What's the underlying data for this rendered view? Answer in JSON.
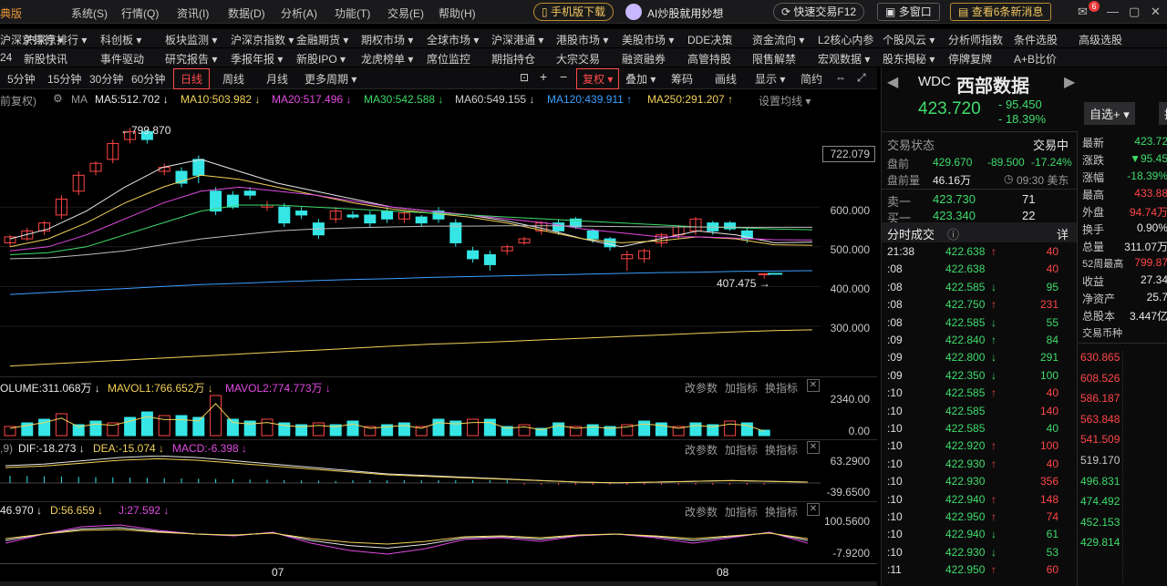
{
  "menubar": {
    "logo": "典版",
    "items": [
      "系统(S)",
      "行情(Q)",
      "资讯(I)",
      "数据(D)",
      "分析(A)",
      "功能(T)",
      "交易(E)",
      "帮助(H)"
    ],
    "mobile_download": "手机版下载",
    "ai_promo": "AI炒股就用妙想",
    "quick_trade": "快速交易F12",
    "multi_window": "多窗口",
    "news": "查看6条新消息",
    "mail_badge": "6"
  },
  "nav1": [
    "沪深京排行 ▾",
    "科创板 ▾",
    "板块监测 ▾",
    "沪深京指数 ▾",
    "金融期货 ▾",
    "期权市场 ▾",
    "全球市场 ▾",
    "沪深港通 ▾",
    "港股市场 ▾",
    "美股市场 ▾",
    "DDE决策",
    "资金流向 ▾",
    "L2核心内参",
    "个股风云 ▾",
    "分析师指数",
    "条件选股",
    "高级选股"
  ],
  "nav2": [
    "新股快讯",
    "事件驱动",
    "研究报告 ▾",
    "季报年报 ▾",
    "新股IPO ▾",
    "龙虎榜单 ▾",
    "席位监控",
    "期指持仓",
    "大宗交易",
    "融资融券",
    "高管持股",
    "限售解禁",
    "宏观数据 ▾",
    "股东揭秘 ▾",
    "停牌复牌",
    "A+B比价"
  ],
  "nav2_lead": "24",
  "toolbar": {
    "periods": [
      "5分钟",
      "15分钟",
      "30分钟",
      "60分钟",
      "日线",
      "周线",
      "月线",
      "更多周期 ▾"
    ],
    "active": "日线",
    "icons_text": [
      "+",
      "−"
    ],
    "fq": "复权 ▾",
    "tools": [
      "叠加 ▾",
      "筹码",
      "画线",
      "显示 ▾",
      "简约"
    ]
  },
  "indicators": {
    "prefix": "前复权)",
    "ma_label": "MA",
    "ma5": "MA5:512.702 ↓",
    "ma10": "MA10:503.982 ↓",
    "ma20": "MA20:517.496 ↓",
    "ma30": "MA30:542.588 ↓",
    "ma60": "MA60:549.155 ↓",
    "ma120": "MA120:439.911 ↑",
    "ma250": "MA250:291.207 ↑",
    "set_ma": "设置均线 ▾",
    "volume": "OLUME:311.068万 ↓",
    "mavol1": "MAVOL1:766.652万 ↓",
    "mavol2": "MAVOL2:774.773万 ↓",
    "macd_prefix": ",9)",
    "dif": "DIF:-18.273 ↓",
    "dea": "DEA:-15.074 ↓",
    "macd": "MACD:-6.398 ↓",
    "kdj_k": "46.970 ↓",
    "kdj_d": "D:56.659 ↓",
    "kdj_j": "J:27.592 ↓",
    "change_param": "改参数",
    "add_ind": "加指标",
    "switch_ind": "换指标"
  },
  "price_axis": [
    "722.079",
    "600.000",
    "500.000",
    "400.000",
    "300.000"
  ],
  "vol_axis": [
    "2340.00",
    "0.00"
  ],
  "macd_axis": [
    "63.2900",
    "-39.6500"
  ],
  "kdj_axis": [
    "100.5600",
    "-7.9200"
  ],
  "annotations": {
    "high": "799.870",
    "low": "407.475"
  },
  "months": [
    "07",
    "08"
  ],
  "colors": {
    "up": "#ff4646",
    "down": "#36e6e6",
    "ma5": "#e8e8e8",
    "ma10": "#f3d25a",
    "ma20": "#e24ae2",
    "ma30": "#3fdc6a",
    "ma60": "#bdbdbd",
    "ma120": "#3aa0ff",
    "ma250": "#f3d25a"
  },
  "quote": {
    "code": "WDC",
    "name": "西部数据",
    "price": "423.720",
    "change": "- 95.450",
    "pct": "- 18.39%",
    "watch": "自选+ ▾",
    "extra_btn": "提",
    "status_label": "交易状态",
    "status_value": "交易中",
    "pre_label": "盘前",
    "pre_price": "429.670",
    "pre_change": "-89.500",
    "pre_pct": "-17.24%",
    "pre_vol_label": "盘前量",
    "pre_vol": "46.16万",
    "time": "09:30 美东",
    "sell_label": "卖一",
    "sell_price": "423.730",
    "sell_vol": "71",
    "buy_label": "买一",
    "buy_price": "423.340",
    "buy_vol": "22",
    "ticks_label": "分时成交",
    "detail": "详"
  },
  "ticks": [
    {
      "t": "21:38",
      "p": "422.638",
      "a": "↑",
      "v": "40",
      "c": "red"
    },
    {
      "t": ":08",
      "p": "422.638",
      "a": "",
      "v": "40",
      "c": "red"
    },
    {
      "t": ":08",
      "p": "422.585",
      "a": "↓",
      "v": "95",
      "c": "grn"
    },
    {
      "t": ":08",
      "p": "422.750",
      "a": "↑",
      "v": "231",
      "c": "red"
    },
    {
      "t": ":08",
      "p": "422.585",
      "a": "↓",
      "v": "55",
      "c": "grn"
    },
    {
      "t": ":09",
      "p": "422.840",
      "a": "↑",
      "v": "84",
      "c": "grn"
    },
    {
      "t": ":09",
      "p": "422.800",
      "a": "↓",
      "v": "291",
      "c": "grn"
    },
    {
      "t": ":09",
      "p": "422.350",
      "a": "↓",
      "v": "100",
      "c": "grn"
    },
    {
      "t": ":10",
      "p": "422.585",
      "a": "↑",
      "v": "40",
      "c": "red"
    },
    {
      "t": ":10",
      "p": "422.585",
      "a": "",
      "v": "140",
      "c": "red"
    },
    {
      "t": ":10",
      "p": "422.585",
      "a": "",
      "v": "40",
      "c": "grn"
    },
    {
      "t": ":10",
      "p": "422.920",
      "a": "↑",
      "v": "100",
      "c": "red"
    },
    {
      "t": ":10",
      "p": "422.930",
      "a": "↑",
      "v": "40",
      "c": "red"
    },
    {
      "t": ":10",
      "p": "422.930",
      "a": "",
      "v": "356",
      "c": "red"
    },
    {
      "t": ":10",
      "p": "422.940",
      "a": "↑",
      "v": "148",
      "c": "red"
    },
    {
      "t": ":10",
      "p": "422.950",
      "a": "↑",
      "v": "74",
      "c": "red"
    },
    {
      "t": ":10",
      "p": "422.940",
      "a": "↓",
      "v": "61",
      "c": "grn"
    },
    {
      "t": ":10",
      "p": "422.930",
      "a": "↓",
      "v": "53",
      "c": "grn"
    },
    {
      "t": ":11",
      "p": "422.950",
      "a": "↑",
      "v": "60",
      "c": "red"
    }
  ],
  "stats": [
    {
      "k": "最新",
      "v": "423.72",
      "c": "grn"
    },
    {
      "k": "涨跌",
      "v": "▼95.45",
      "c": "grn"
    },
    {
      "k": "涨幅",
      "v": "-18.39%",
      "c": "grn"
    },
    {
      "k": "最高",
      "v": "433.88",
      "c": "red"
    },
    {
      "k": "外盘",
      "v": "94.74万",
      "c": "red"
    },
    {
      "k": "换手",
      "v": "0.90%",
      "c": "wht"
    },
    {
      "k": "总量",
      "v": "311.07万",
      "c": "wht"
    },
    {
      "k": "52周最高",
      "v": "799.87",
      "c": "red"
    },
    {
      "k": "收益",
      "v": "27.34",
      "c": "wht"
    },
    {
      "k": "净资产",
      "v": "25.7",
      "c": "wht"
    },
    {
      "k": "总股本",
      "v": "3.447亿",
      "c": "wht"
    },
    {
      "k": "交易币种",
      "v": "",
      "c": "wht"
    }
  ],
  "mini_axis": [
    "630.865",
    "608.526",
    "586.187",
    "563.848",
    "541.509",
    "519.170",
    "496.831",
    "474.492",
    "452.153",
    "429.814"
  ]
}
